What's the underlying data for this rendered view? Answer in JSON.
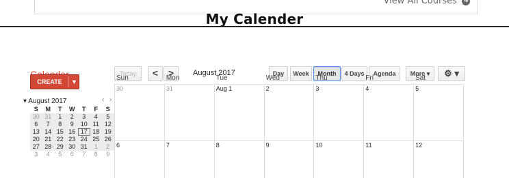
{
  "top": {
    "view_all": "View All Courses"
  },
  "page": {
    "heading": "My Calender"
  },
  "app": {
    "title": "Calendar"
  },
  "toolbar": {
    "today": "Today",
    "prev": "<",
    "next": ">",
    "range": "August 2017",
    "views": [
      "Day",
      "Week",
      "Month",
      "4 Days",
      "Agenda"
    ],
    "selected_view": "Month",
    "more": "More ▾",
    "settings": "⚙ ▾"
  },
  "create": {
    "label": "CREATE",
    "arrow": "▼"
  },
  "mini": {
    "toggle": "▾",
    "month": "August 2017",
    "prev": "‹",
    "next": "›",
    "dow": [
      "S",
      "M",
      "T",
      "W",
      "T",
      "F",
      "S"
    ],
    "weeks": [
      [
        "30",
        "31",
        "1",
        "2",
        "3",
        "4",
        "5"
      ],
      [
        "6",
        "7",
        "8",
        "9",
        "10",
        "11",
        "12"
      ],
      [
        "13",
        "14",
        "15",
        "16",
        "17",
        "18",
        "19"
      ],
      [
        "20",
        "21",
        "22",
        "23",
        "24",
        "25",
        "26"
      ],
      [
        "27",
        "28",
        "29",
        "30",
        "31",
        "1",
        "2"
      ],
      [
        "3",
        "4",
        "5",
        "6",
        "7",
        "8",
        "9"
      ]
    ],
    "today": "17"
  },
  "month": {
    "dow": [
      "Sun",
      "Mon",
      "Tue",
      "Wed",
      "Thu",
      "Fri",
      "Sat"
    ],
    "week1": [
      "30",
      "31",
      "Aug 1",
      "2",
      "3",
      "4",
      "5"
    ],
    "week2": [
      "6",
      "7",
      "8",
      "9",
      "10",
      "11",
      "12"
    ]
  },
  "colors": {
    "accent_red": "#dd4b39",
    "create_bg": "#d14836",
    "selected_border": "#4d90fe"
  }
}
